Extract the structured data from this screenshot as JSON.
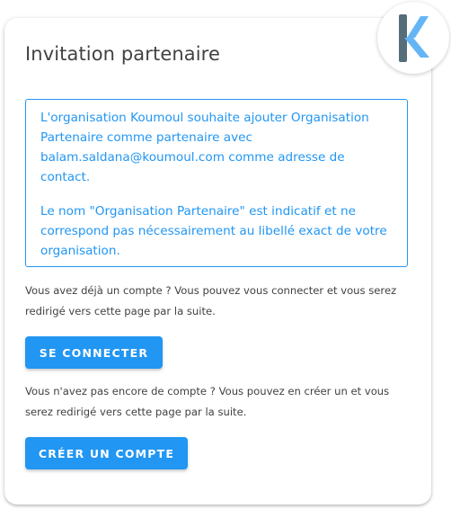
{
  "card": {
    "title": "Invitation partenaire",
    "info": {
      "paragraph1": "L'organisation Koumoul souhaite ajouter Organisation Partenaire comme partenaire avec balam.saldana@koumoul.com comme adresse de contact.",
      "paragraph2": "Le nom \"Organisation Partenaire\" est indicatif et ne correspond pas nécessairement au libellé exact de votre organisation."
    },
    "login": {
      "help_text": "Vous avez déjà un compte ? Vous pouvez vous connecter et vous serez redirigé vers cette page par la suite.",
      "button_label": "SE CONNECTER"
    },
    "signup": {
      "help_text": "Vous n'avez pas encore de compte ? Vous pouvez en créer un et vous serez redirigé vers cette page par la suite.",
      "button_label": "CRÉER UN COMPTE"
    }
  },
  "logo": {
    "icon": "koumoul-k-logo-icon"
  },
  "colors": {
    "accent": "#2196f3",
    "text": "#424242",
    "logo_dark": "#546e7a",
    "logo_light": "#64b5f6"
  }
}
